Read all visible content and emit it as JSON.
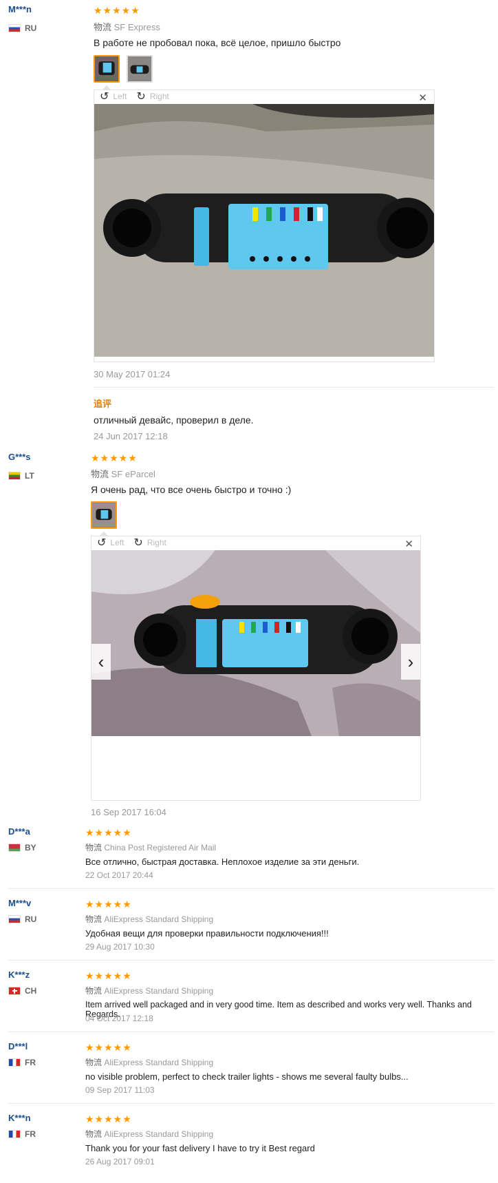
{
  "reviews": [
    {
      "user": "M***n",
      "country": "RU",
      "ship_label": "物流",
      "shipping": "SF Express",
      "text": "В работе не пробовал пока, всё целое, пришло быстро",
      "date": "30 May 2017 01:24",
      "append_label": "追评",
      "append_text": "отличный девайс, проверил в деле.",
      "append_date": "24 Jun 2017 12:18",
      "viewer": {
        "left": "Left",
        "right": "Right"
      }
    },
    {
      "user": "G***s",
      "country": "LT",
      "ship_label": "物流",
      "shipping": "SF eParcel",
      "text": "Я очень рад, что все очень быстро и точно :)",
      "date": "16 Sep 2017 16:04",
      "viewer": {
        "left": "Left",
        "right": "Right"
      }
    },
    {
      "user": "D***a",
      "country": "BY",
      "ship_label": "物流",
      "shipping": "China Post Registered Air Mail",
      "text": "Все отлично, быстрая доставка. Неплохое изделие за эти деньги.",
      "date": "22 Oct 2017 20:44"
    },
    {
      "user": "M***v",
      "country": "RU",
      "ship_label": "物流",
      "shipping": "AliExpress Standard Shipping",
      "text": "Удобная вещи для проверки правильности подключения!!!",
      "date": "29 Aug 2017 10:30"
    },
    {
      "user": "K***z",
      "country": "CH",
      "ship_label": "物流",
      "shipping": "AliExpress Standard Shipping",
      "text": "Item arrived well packaged and in very good time. Item as described and works very well. Thanks and Regards.",
      "date": "04 Oct 2017 12:18"
    },
    {
      "user": "D***l",
      "country": "FR",
      "ship_label": "物流",
      "shipping": "AliExpress Standard Shipping",
      "text": "no visible problem, perfect to check trailer lights - shows me several faulty bulbs...",
      "date": "09 Sep 2017 11:03"
    },
    {
      "user": "K***n",
      "country": "FR",
      "ship_label": "物流",
      "shipping": "AliExpress Standard Shipping",
      "text": "Thank you for your fast delivery I have to try it Best regard",
      "date": "26 Aug 2017 09:01"
    }
  ],
  "stars": "★★★★★",
  "icons": {
    "rotate_left": "rotate-left-icon",
    "rotate_right": "rotate-right-icon",
    "close": "close-icon",
    "prev": "chevron-left-icon",
    "next": "chevron-right-icon"
  }
}
